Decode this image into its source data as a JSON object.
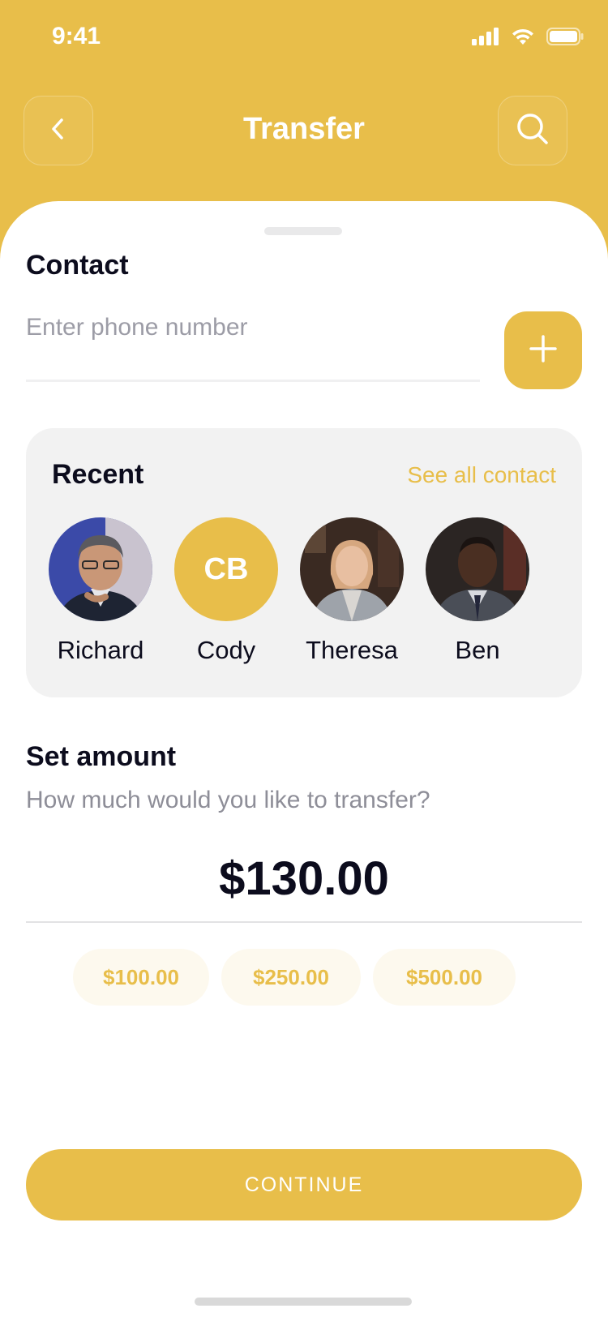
{
  "status_bar": {
    "time": "9:41"
  },
  "header": {
    "title": "Transfer"
  },
  "contact_section": {
    "title": "Contact",
    "phone_placeholder": "Enter phone number"
  },
  "recent": {
    "title": "Recent",
    "see_all_label": "See all contact",
    "contacts": [
      {
        "name": "Richard",
        "avatar": "photo"
      },
      {
        "name": "Cody",
        "initials": "CB"
      },
      {
        "name": "Theresa",
        "avatar": "photo"
      },
      {
        "name": "Ben",
        "avatar": "photo"
      }
    ]
  },
  "amount_section": {
    "title": "Set amount",
    "subtitle": "How much would you like to transfer?",
    "value": "$130.00",
    "quick_amounts": [
      "$100.00",
      "$250.00",
      "$500.00"
    ]
  },
  "continue_label": "CONTINUE",
  "colors": {
    "accent": "#E8BE4A",
    "text_primary": "#0C0C1D",
    "text_secondary": "#8E8E98",
    "card_bg": "#F2F2F2",
    "chip_bg": "#FDF9EE"
  }
}
